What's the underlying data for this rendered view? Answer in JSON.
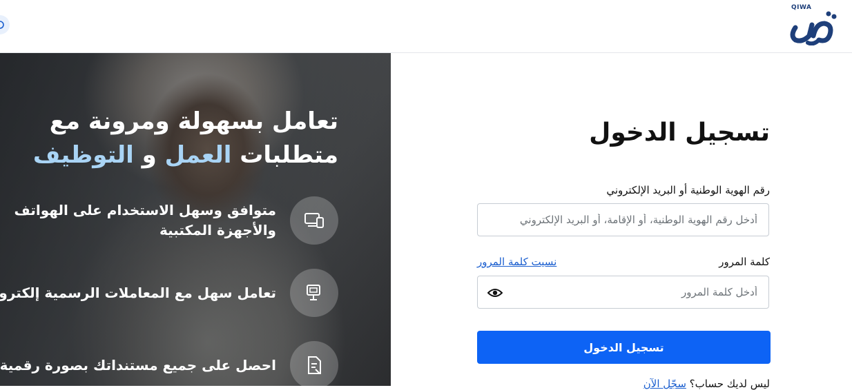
{
  "header": {
    "logo_text": "QIWA",
    "logo_label": "قوى"
  },
  "hero": {
    "title_line1": "تعامل بسهولة ومرونة مع",
    "title_line2_part1": "متطلبات ",
    "title_line2_highlight1": "العمل",
    "title_line2_part2": " و ",
    "title_line2_highlight2": "التوظيف",
    "highlight_color": "#a9d4f5",
    "features": [
      {
        "icon": "devices-icon",
        "text_line1": "متوافق وسهل الاستخدام على الهواتف",
        "text_line2": "والأجهزة المكتبية"
      },
      {
        "icon": "monitor-icon",
        "text_line1": "تعامل سهل مع المعاملات الرسمية إلكترونياً",
        "text_line2": ""
      },
      {
        "icon": "document-icon",
        "text_line1": "احصل على جميع مستنداتك بصورة رقمية",
        "text_line2": ""
      }
    ]
  },
  "login": {
    "title": "تسجيل الدخول",
    "id_label": "رقم الهوية الوطنية أو البريد الإلكتروني",
    "id_placeholder": "أدخل رقم الهوية الوطنية، أو الإقامة، أو البريد الإلكتروني",
    "id_value": "",
    "password_label": "كلمة المرور",
    "forgot_password": "نسيت كلمة المرور",
    "password_placeholder": "أدخل كلمة المرور",
    "password_value": "",
    "submit_label": "تسجيل الدخول",
    "signup_text": "ليس لديك حساب؟",
    "signup_link": "سجّل الآن",
    "accent_color": "#0d63f5"
  }
}
